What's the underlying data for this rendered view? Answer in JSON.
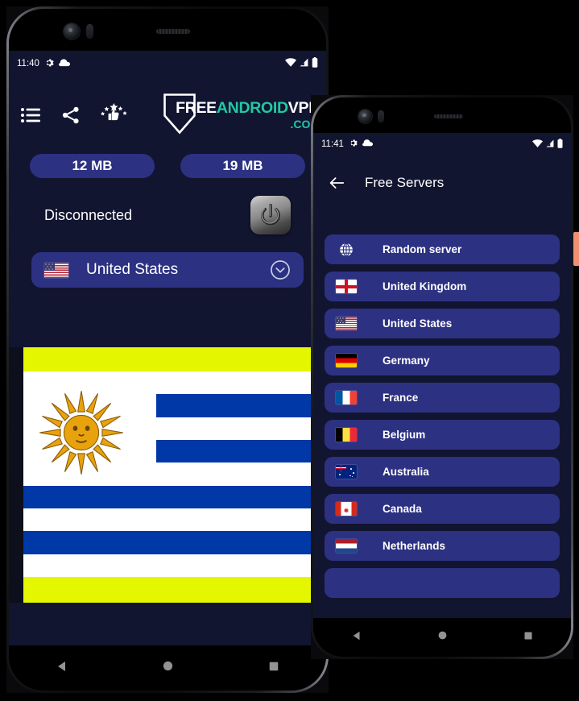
{
  "background_color": "#000000",
  "phone_main": {
    "status_bar": {
      "time": "11:40",
      "icons_left": [
        "gear-icon",
        "cloud-icon"
      ],
      "icons_right": [
        "wifi-icon",
        "signal-icon",
        "battery-icon"
      ]
    },
    "toolbar": {
      "icons": [
        {
          "name": "list-icon",
          "label": "Server list"
        },
        {
          "name": "share-icon",
          "label": "Share"
        },
        {
          "name": "rate-icon",
          "label": "Rate us"
        }
      ],
      "logo": {
        "part1": "FREE",
        "part2": "ANDROID",
        "part3": "VPN",
        "part4": ".COM",
        "color_white": "#ffffff",
        "color_teal": "#21c9a3"
      }
    },
    "stats": {
      "download": "12 MB",
      "upload": "19 MB",
      "badge_color": "#2c3182"
    },
    "connection": {
      "status": "Disconnected",
      "power_button": "power-icon"
    },
    "server_selector": {
      "flag": "us-flag",
      "label": "United States",
      "chevron": "chevron-down-icon"
    },
    "ad_banner": {
      "type": "uruguay-flag-banner",
      "band_color": "#e4f700",
      "flag_blue": "#0038a8",
      "flag_white": "#ffffff",
      "sun_color": "#e8a30c"
    },
    "nav_bar": {
      "back": "back-triangle-icon",
      "home": "home-circle-icon",
      "recents": "recents-square-icon"
    }
  },
  "phone_servers": {
    "status_bar": {
      "time": "11:41",
      "icons_left": [
        "gear-icon",
        "cloud-icon"
      ],
      "icons_right": [
        "wifi-icon",
        "signal-icon",
        "battery-icon"
      ]
    },
    "header": {
      "back_icon": "arrow-left-icon",
      "title": "Free Servers"
    },
    "servers": [
      {
        "flag": "globe-icon",
        "name": "Random server"
      },
      {
        "flag": "uk-flag",
        "name": "United Kingdom"
      },
      {
        "flag": "us-flag",
        "name": "United States"
      },
      {
        "flag": "de-flag",
        "name": "Germany"
      },
      {
        "flag": "fr-flag",
        "name": "France"
      },
      {
        "flag": "be-flag",
        "name": "Belgium"
      },
      {
        "flag": "au-flag",
        "name": "Australia"
      },
      {
        "flag": "ca-flag",
        "name": "Canada"
      },
      {
        "flag": "nl-flag",
        "name": "Netherlands"
      }
    ],
    "item_color": "#2c3182",
    "nav_bar": {
      "back": "back-triangle-icon",
      "home": "home-circle-icon",
      "recents": "recents-square-icon"
    }
  }
}
